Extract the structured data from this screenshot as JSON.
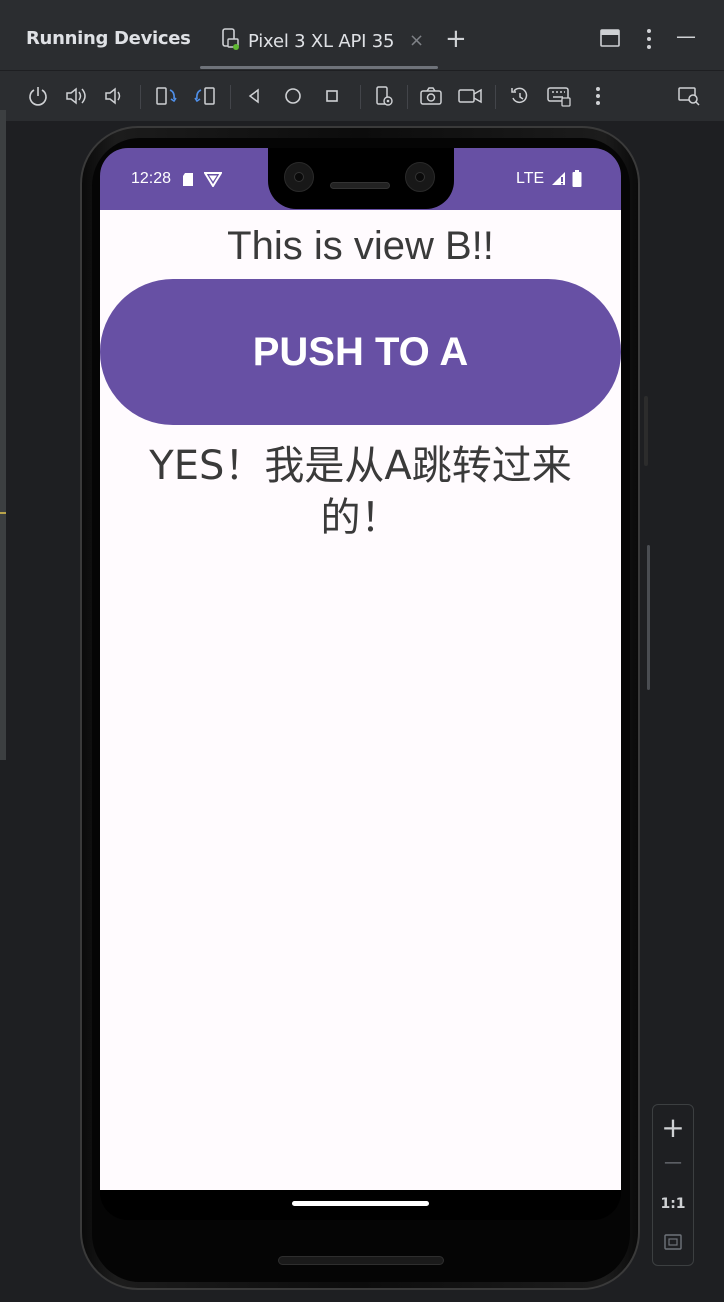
{
  "panel": {
    "title": "Running Devices"
  },
  "tab": {
    "label": "Pixel 3 XL API 35",
    "close_glyph": "×",
    "add_glyph": "+"
  },
  "window_controls": {
    "layout_icon": "window-layout-icon",
    "more_icon": "more-vertical-icon",
    "minimize_glyph": "—"
  },
  "toolbar": {
    "icons": [
      "power-icon",
      "volume-up-icon",
      "volume-down-icon",
      "rotate-left-icon",
      "rotate-right-icon",
      "back-icon",
      "home-icon",
      "overview-icon",
      "device-settings-icon",
      "screenshot-icon",
      "screen-record-icon",
      "snapshot-restore-icon",
      "keyboard-icon",
      "more-icon",
      "window-search-icon"
    ]
  },
  "status_bar": {
    "time": "12:28",
    "network": "LTE"
  },
  "app": {
    "headline": "This is view B!!",
    "push_button_label": "PUSH TO A",
    "message": "YES！我是从A跳转过来的！"
  },
  "zoom": {
    "zoom_in": "+",
    "zoom_out": "—",
    "actual_size": "1:1"
  },
  "colors": {
    "app_bar": "#6750a4",
    "ide_bg": "#2b2d30",
    "app_bg": "#fffbfe"
  }
}
